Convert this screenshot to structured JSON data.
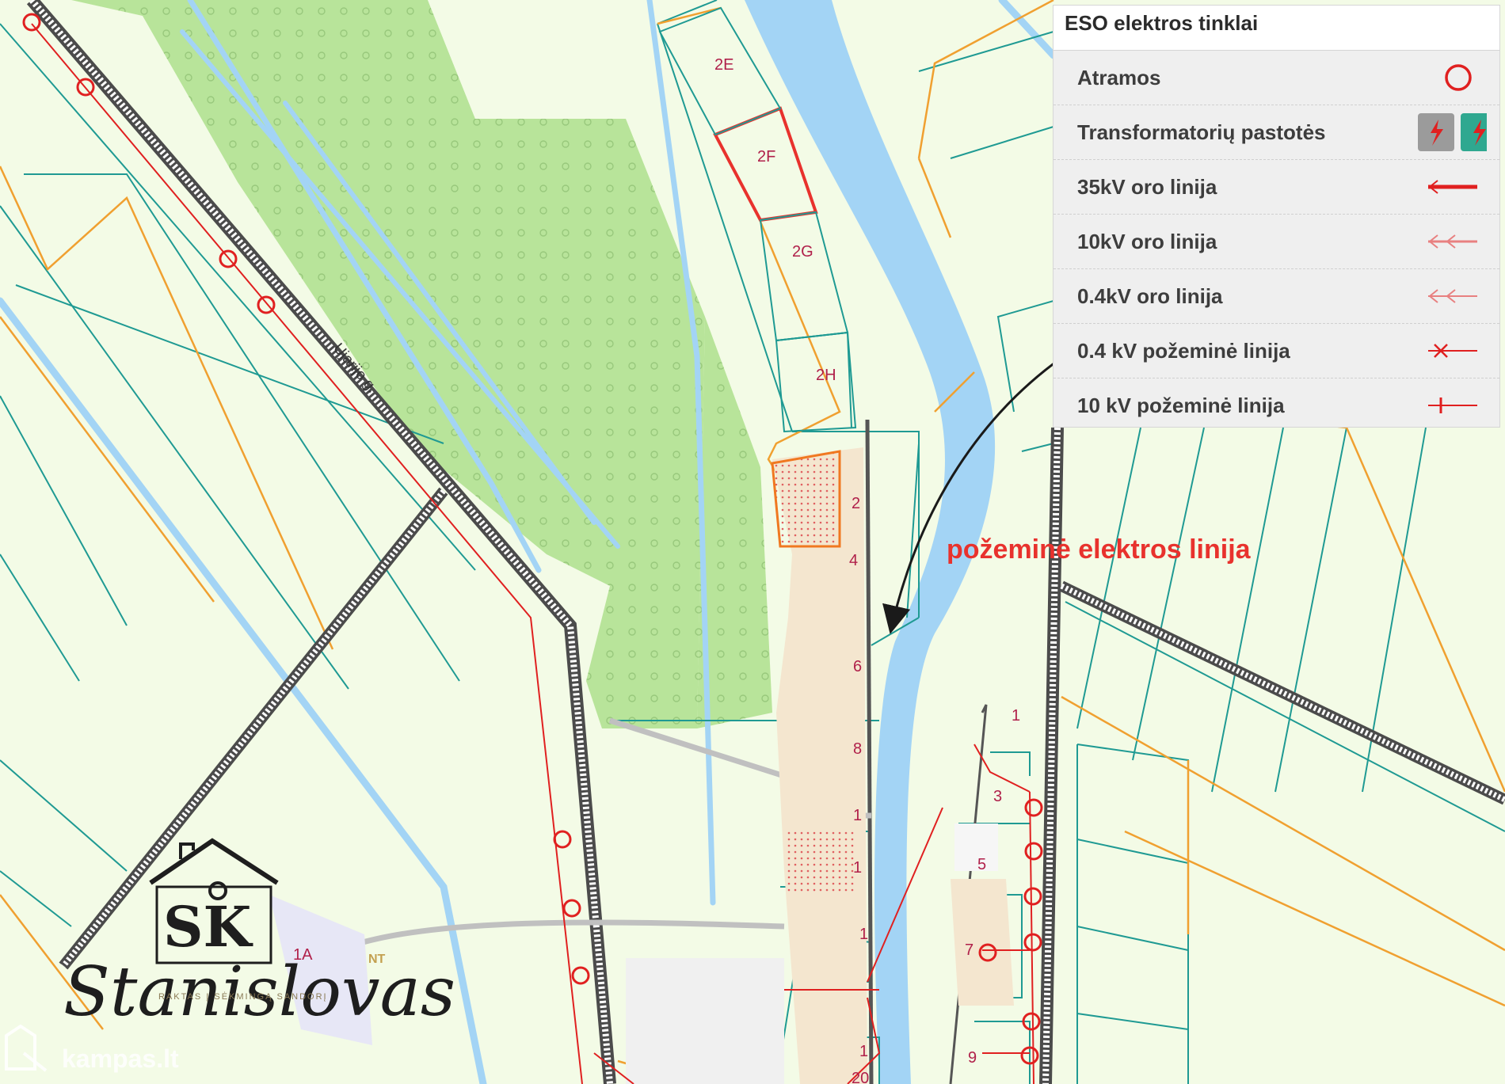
{
  "legend": {
    "title": "ESO elektros tinklai",
    "items": [
      {
        "label": "Atramos",
        "symbol": "pole-circle-icon"
      },
      {
        "label": "Transformatorių pastotės",
        "symbol": "substation-icon"
      },
      {
        "label": "35kV oro linija",
        "symbol": "line-35kv-icon"
      },
      {
        "label": "10kV oro linija",
        "symbol": "line-10kv-air-icon"
      },
      {
        "label": "0.4kV oro linija",
        "symbol": "line-04kv-air-icon"
      },
      {
        "label": "0.4 kV požeminė linija",
        "symbol": "line-04kv-underground-icon"
      },
      {
        "label": "10 kV požeminė linija",
        "symbol": "line-10kv-underground-icon"
      }
    ]
  },
  "annotation": "požeminė elektros linija",
  "street": "Ujarijo g.",
  "plots": [
    "2E",
    "2F",
    "2G",
    "2H",
    "2",
    "4",
    "6",
    "8",
    "1",
    "1",
    "1",
    "1",
    "1",
    "3",
    "5",
    "7",
    "9",
    "1A",
    "20"
  ],
  "logo": {
    "initials": "SK",
    "script": "Stanislovas",
    "tagline": "RAKTAS Į SĖKMINGĄ SANDORĮ",
    "badge": "NT"
  },
  "watermark": "kampas.lt",
  "colors": {
    "background": "#f3fbe6",
    "forest": "#b8e49a",
    "water": "#a3d4f5",
    "parcel": "#1f9a93",
    "boundary": "#f0a030",
    "power": "#e02020",
    "selected_parcel": "#e8322d",
    "railway": "#555555"
  }
}
